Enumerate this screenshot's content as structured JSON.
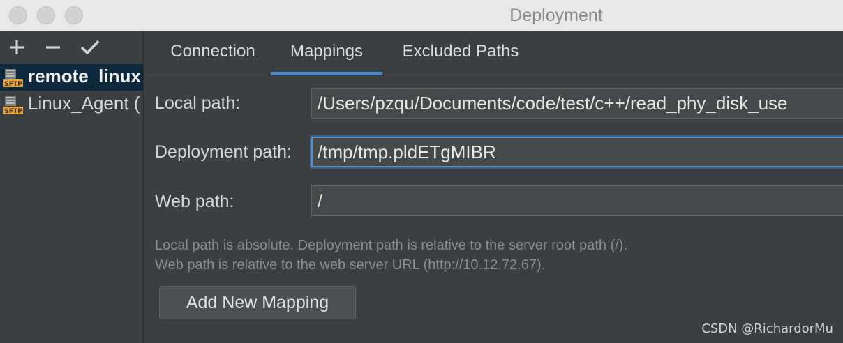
{
  "window": {
    "title": "Deployment"
  },
  "toolbar": {
    "add_icon": "plus-icon",
    "remove_icon": "minus-icon",
    "apply_icon": "check-icon"
  },
  "servers": [
    {
      "label": "remote_linux",
      "icon": "sftp-icon",
      "selected": true
    },
    {
      "label": "Linux_Agent (",
      "icon": "sftp-icon",
      "selected": false
    }
  ],
  "tabs": [
    "Connection",
    "Mappings",
    "Excluded Paths"
  ],
  "active_tab": "Mappings",
  "mapping": {
    "local_label": "Local path:",
    "local_value": "/Users/pzqu/Documents/code/test/c++/read_phy_disk_use",
    "deploy_label": "Deployment path:",
    "deploy_value": "/tmp/tmp.pldETgMIBR",
    "web_label": "Web path:",
    "web_value": "/"
  },
  "hints": [
    "Local path is absolute. Deployment path is relative to the server root path (/).",
    "Web path is relative to the web server URL (http://10.12.72.67)."
  ],
  "add_mapping_label": "Add New Mapping",
  "watermark": "CSDN @RichardorMu",
  "colors": {
    "accent": "#4a88c7",
    "selection": "#0d293e",
    "background": "#3c3f41",
    "sftp_badge": "#e8a33c"
  }
}
